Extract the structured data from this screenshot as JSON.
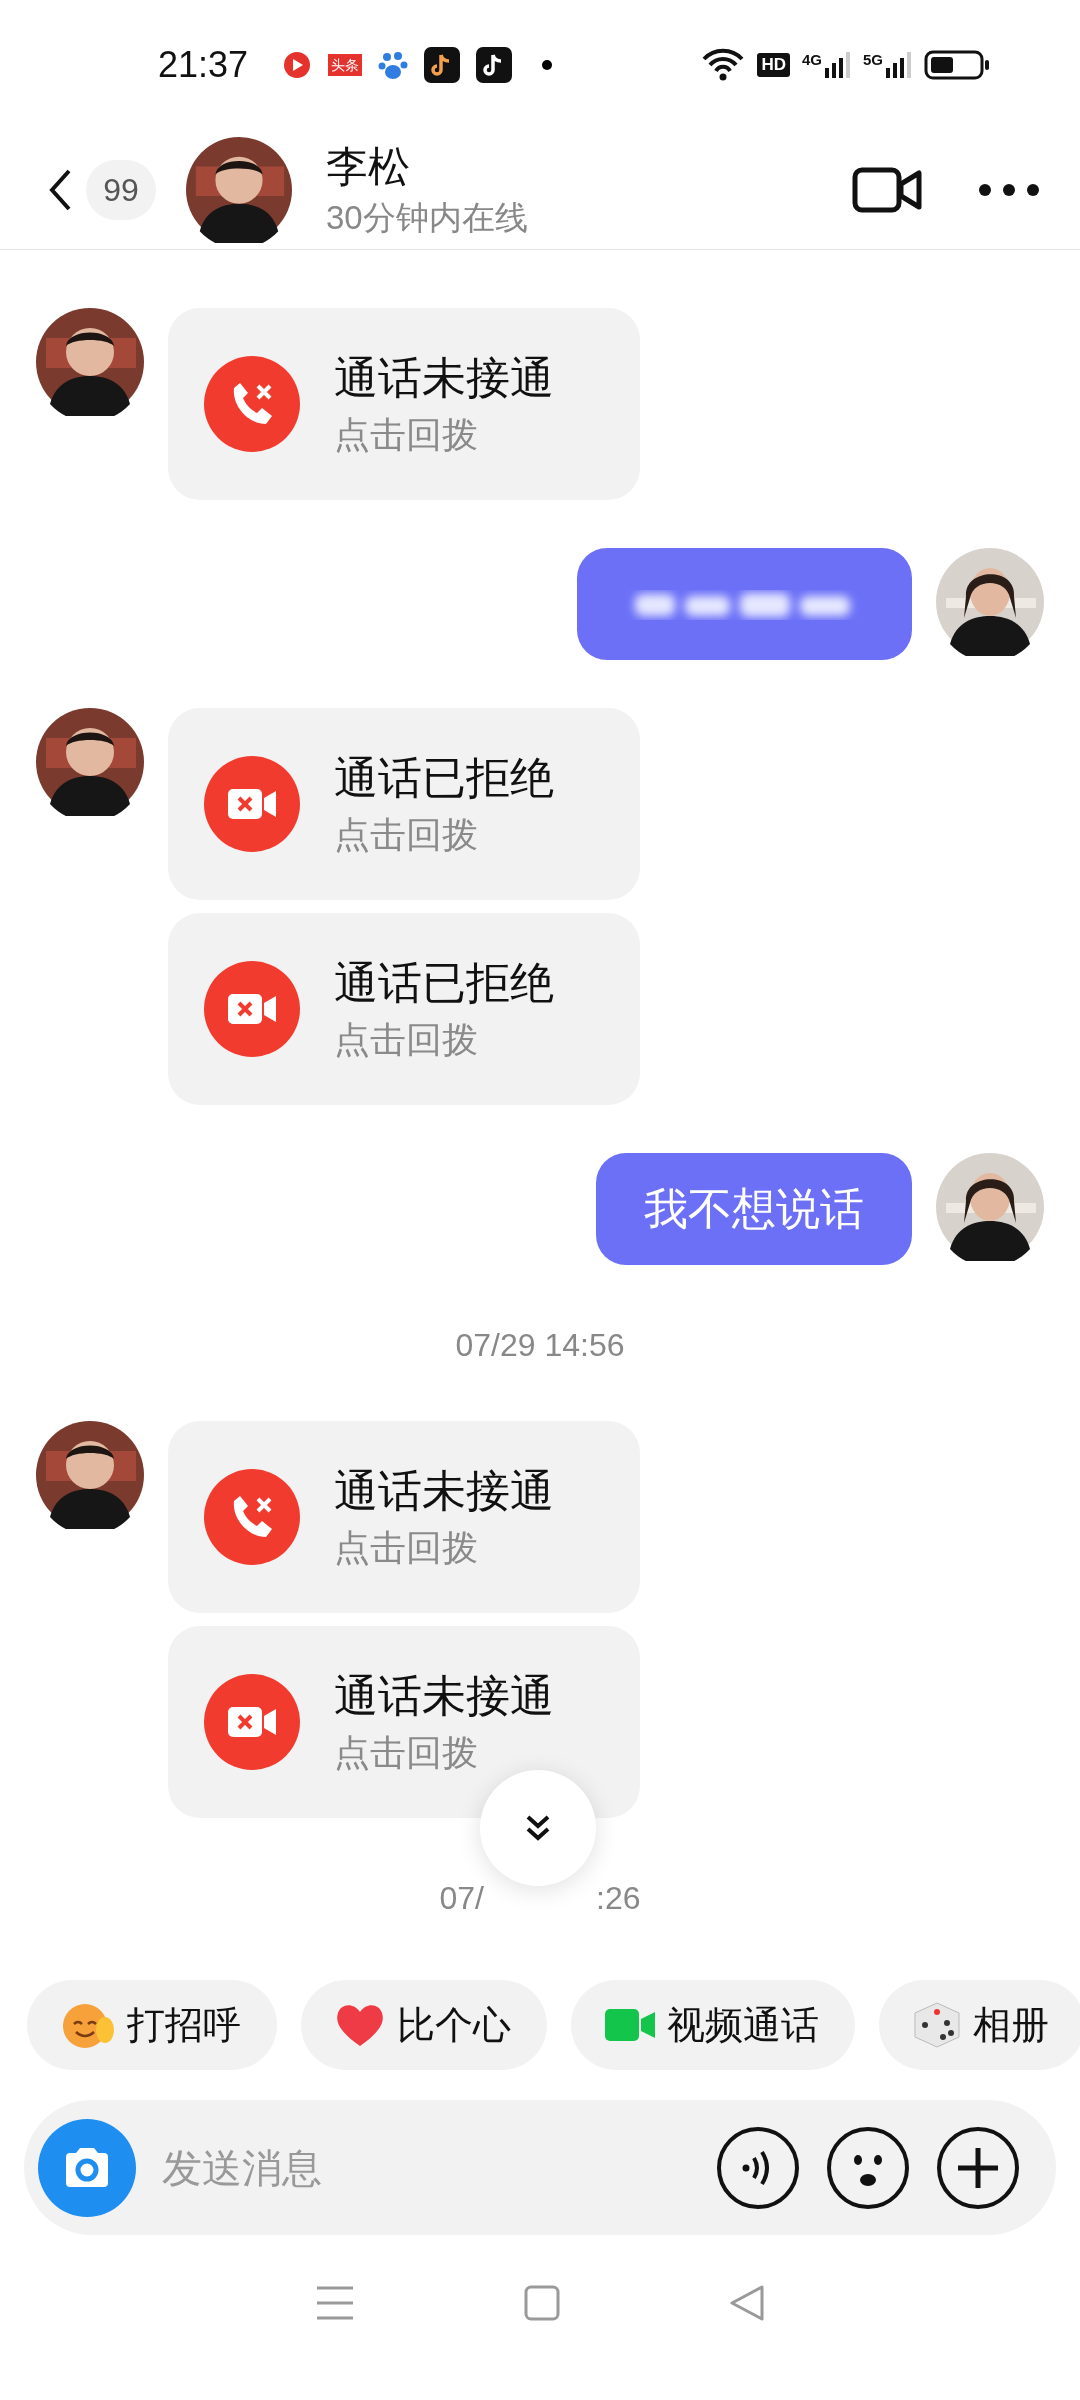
{
  "status_bar": {
    "time": "21:37",
    "news_app_label": "头条",
    "hd_label": "HD",
    "networks": [
      "4G",
      "5G"
    ]
  },
  "header": {
    "back_badge": "99",
    "name": "李松",
    "presence": "30分钟内在线"
  },
  "messages": [
    {
      "kind": "voice_call",
      "outgoing": false,
      "show_avatar": true,
      "title": "通话未接通",
      "subtitle": "点击回拨"
    },
    {
      "kind": "redacted",
      "outgoing": true,
      "show_avatar": true
    },
    {
      "kind": "video_call",
      "outgoing": false,
      "show_avatar": true,
      "title": "通话已拒绝",
      "subtitle": "点击回拨"
    },
    {
      "kind": "video_call",
      "outgoing": false,
      "show_avatar": false,
      "title": "通话已拒绝",
      "subtitle": "点击回拨"
    },
    {
      "kind": "text",
      "outgoing": true,
      "show_avatar": true,
      "text": "我不想说话"
    },
    {
      "kind": "timestamp",
      "text": "07/29 14:56"
    },
    {
      "kind": "voice_call",
      "outgoing": false,
      "show_avatar": true,
      "title": "通话未接通",
      "subtitle": "点击回拨"
    },
    {
      "kind": "video_call",
      "outgoing": false,
      "show_avatar": false,
      "title": "通话未接通",
      "subtitle": "点击回拨"
    },
    {
      "kind": "covered_timestamp",
      "parts": [
        "07/",
        ":26"
      ]
    }
  ],
  "quick_actions": [
    {
      "kind": "wave",
      "label": "打招呼"
    },
    {
      "kind": "heart",
      "label": "比个心"
    },
    {
      "kind": "video",
      "label": "视频通话"
    },
    {
      "kind": "dice",
      "label": "相册"
    }
  ],
  "composer": {
    "placeholder": "发送消息"
  }
}
